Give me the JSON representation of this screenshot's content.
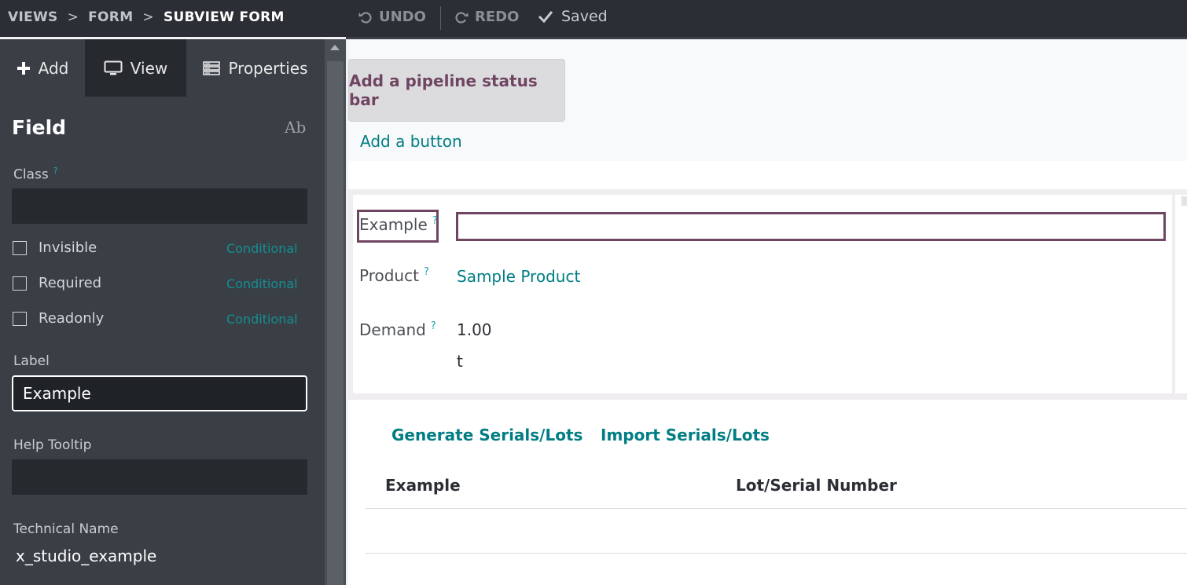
{
  "topbar": {
    "breadcrumbs": [
      "VIEWS",
      "FORM",
      "SUBVIEW FORM"
    ],
    "separator": ">",
    "undo_label": "UNDO",
    "redo_label": "REDO",
    "saved_label": "Saved"
  },
  "sidebar": {
    "tabs": [
      {
        "label": "Add",
        "icon": "plus-icon"
      },
      {
        "label": "View",
        "icon": "monitor-icon"
      },
      {
        "label": "Properties",
        "icon": "properties-icon"
      }
    ],
    "title": "Field",
    "type_icon_text": "Ab",
    "class_label": "Class",
    "help_mark": "?",
    "class_value": "",
    "checkboxes": [
      {
        "label": "Invisible",
        "conditional": "Conditional",
        "checked": false
      },
      {
        "label": "Required",
        "conditional": "Conditional",
        "checked": false
      },
      {
        "label": "Readonly",
        "conditional": "Conditional",
        "checked": false
      }
    ],
    "label_label": "Label",
    "label_value": "Example",
    "help_tooltip_label": "Help Tooltip",
    "help_tooltip_value": "",
    "technical_name_label": "Technical Name",
    "technical_name_value": "x_studio_example"
  },
  "main": {
    "pipeline_button": "Add a pipeline status bar",
    "add_button_link": "Add a button",
    "fields": [
      {
        "label": "Example",
        "value": ""
      },
      {
        "label": "Product",
        "value": "Sample Product"
      },
      {
        "label": "Demand",
        "value": "1.00",
        "unit": "t"
      }
    ],
    "actions": {
      "generate": "Generate Serials/Lots",
      "import": "Import Serials/Lots"
    },
    "table": {
      "columns": [
        "Example",
        "Lot/Serial Number"
      ]
    }
  },
  "colors": {
    "accent": "#017e84",
    "highlight": "#6f4561"
  }
}
